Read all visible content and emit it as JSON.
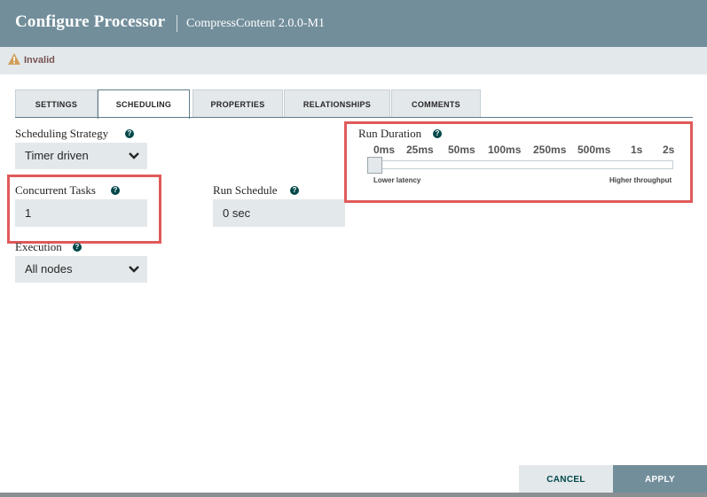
{
  "dialog": {
    "title": "Configure Processor",
    "subtitle": "CompressContent 2.0.0-M1"
  },
  "status": {
    "text": "Invalid",
    "icon": "warning-triangle-icon"
  },
  "tabs": [
    {
      "label": "SETTINGS"
    },
    {
      "label": "SCHEDULING"
    },
    {
      "label": "PROPERTIES"
    },
    {
      "label": "RELATIONSHIPS"
    },
    {
      "label": "COMMENTS"
    }
  ],
  "active_tab": "SCHEDULING",
  "scheduling_strategy": {
    "label": "Scheduling Strategy",
    "value": "Timer driven"
  },
  "concurrent_tasks": {
    "label": "Concurrent Tasks",
    "value": "1"
  },
  "run_schedule": {
    "label": "Run Schedule",
    "value": "0 sec"
  },
  "execution": {
    "label": "Execution",
    "value": "All nodes"
  },
  "run_duration": {
    "label": "Run Duration",
    "ticks": [
      "0ms",
      "25ms",
      "50ms",
      "100ms",
      "250ms",
      "500ms",
      "1s",
      "2s"
    ],
    "selected": "0ms",
    "low_label": "Lower latency",
    "high_label": "Higher throughput"
  },
  "help_glyph": "?",
  "footer": {
    "cancel_label": "CANCEL",
    "apply_label": "APPLY"
  },
  "colors": {
    "header": "#728e9b",
    "highlight": "#e05a5a",
    "field_bg": "#e3e8eb",
    "accent": "#004849"
  }
}
